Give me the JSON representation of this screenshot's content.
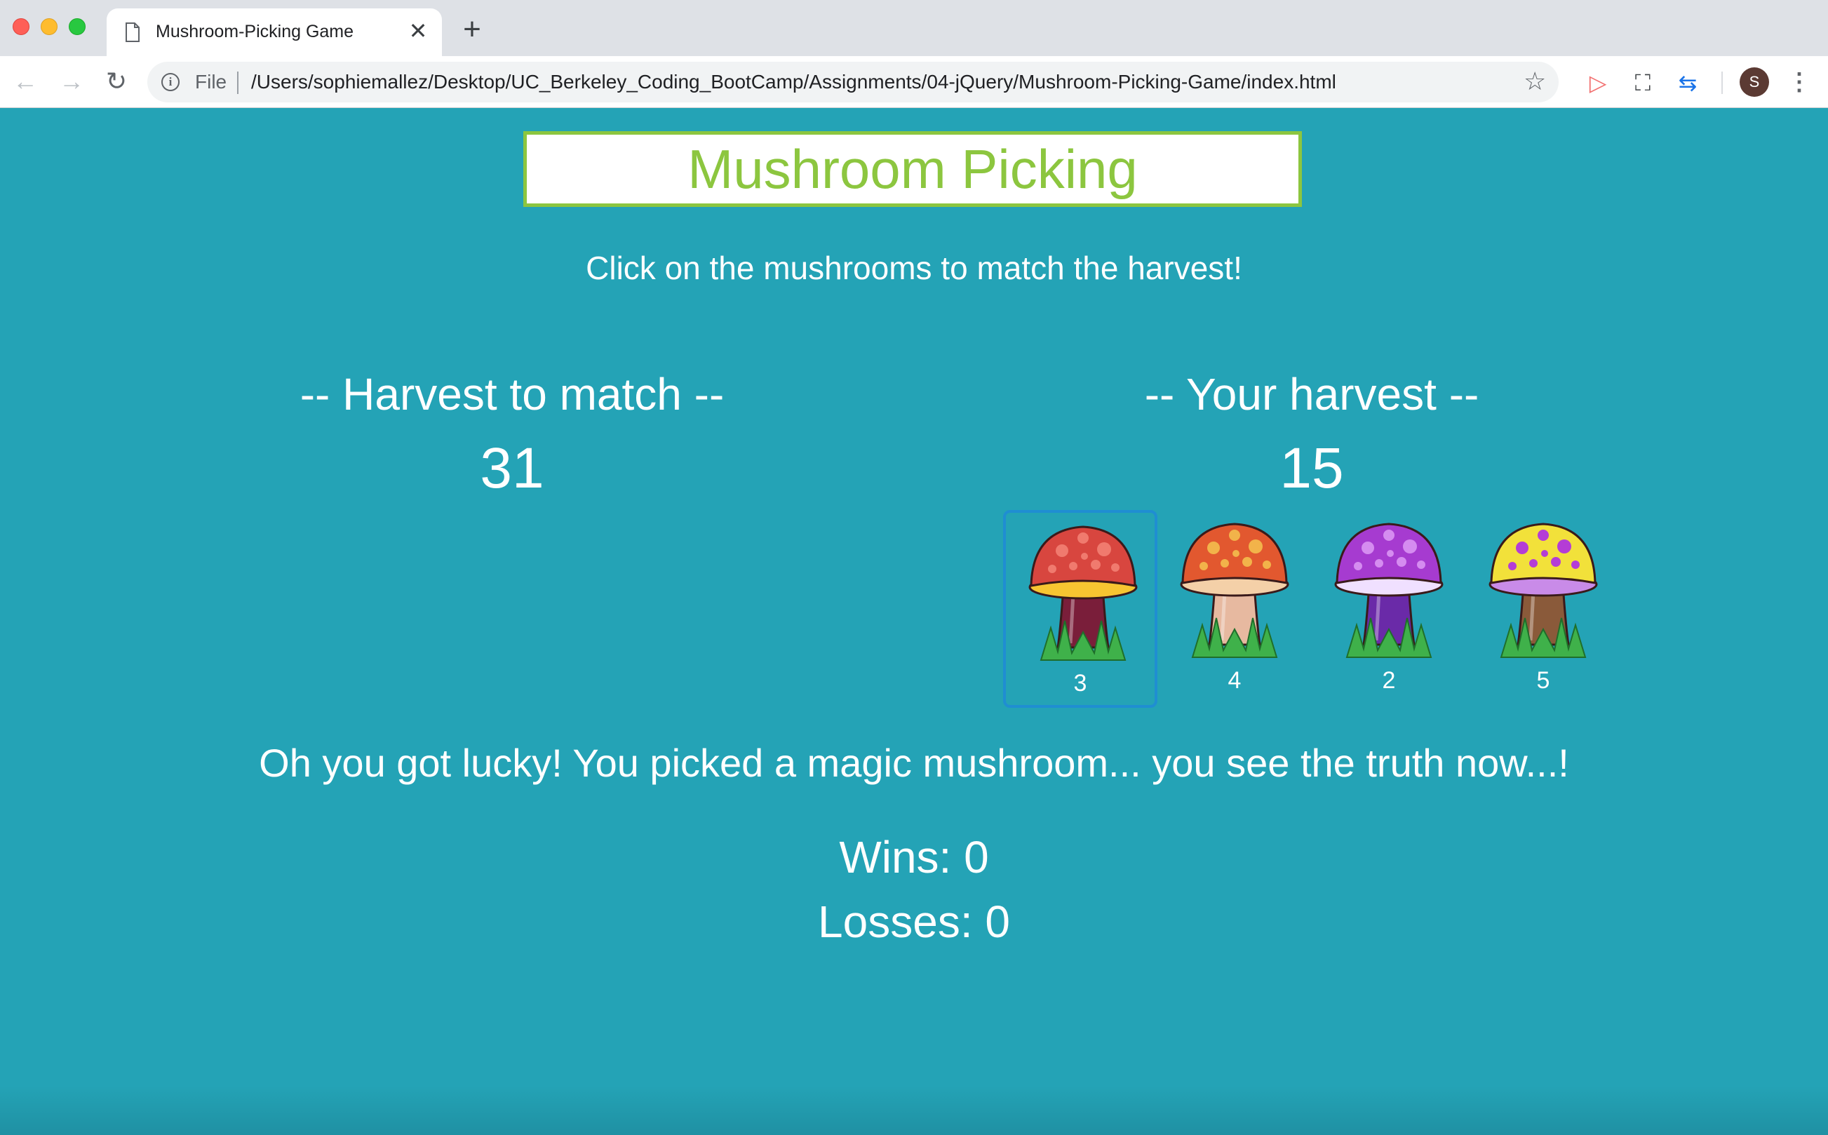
{
  "browser": {
    "tab_title": "Mushroom-Picking Game",
    "tab_close": "✕",
    "new_tab": "+",
    "file_label": "File",
    "url": "/Users/sophiemallez/Desktop/UC_Berkeley_Coding_BootCamp/Assignments/04-jQuery/Mushroom-Picking-Game/index.html",
    "avatar_letter": "S"
  },
  "game": {
    "title": "Mushroom Picking",
    "instructions": "Click on the mushrooms to match the harvest!",
    "target_heading": "-- Harvest to match --",
    "target_value": "31",
    "harvest_heading": "-- Your harvest --",
    "harvest_value": "15",
    "mushrooms": [
      {
        "value": "3",
        "cap_color": "#d8463f",
        "spot_color": "#f07a6e",
        "rim_color": "#f7c531",
        "stem_color": "#7a1e3a",
        "selected": true
      },
      {
        "value": "4",
        "cap_color": "#e2582f",
        "spot_color": "#f2b34a",
        "rim_color": "#f4d0a8",
        "stem_color": "#e7b9a0",
        "selected": false
      },
      {
        "value": "2",
        "cap_color": "#a63bd0",
        "spot_color": "#d58cf0",
        "rim_color": "#f0e0ff",
        "stem_color": "#6a2aa8",
        "selected": false
      },
      {
        "value": "5",
        "cap_color": "#f2e13a",
        "spot_color": "#b43dd6",
        "rim_color": "#c98be8",
        "stem_color": "#8a5a3a",
        "selected": false
      }
    ],
    "message": "Oh you got lucky! You picked a magic mushroom... you see the truth now...!",
    "wins_label": "Wins: 0",
    "losses_label": "Losses: 0"
  },
  "colors": {
    "page_background": "#24a3b6",
    "title_green": "#8cc63f",
    "selection_border": "#1f8ed2"
  }
}
